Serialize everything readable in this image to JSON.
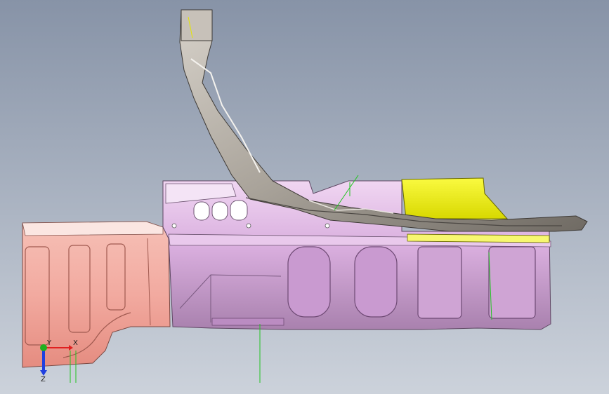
{
  "viewport": {
    "background_top": "#8793a7",
    "background_bottom": "#ccd2db"
  },
  "parts": {
    "rear_extension": {
      "color": "#f2aaa0"
    },
    "main_panel": {
      "color": "#d9aede"
    },
    "yellow_bracket": {
      "color": "#f0f000"
    },
    "gray_arm": {
      "color": "#a9a39a"
    },
    "green_sketch_lines": {
      "color": "#22c422"
    }
  },
  "triad": {
    "x_label": "X",
    "y_label": "Y",
    "z_label": "Z",
    "x_color": "#e02020",
    "y_color": "#20b020",
    "z_color": "#2040e0"
  }
}
